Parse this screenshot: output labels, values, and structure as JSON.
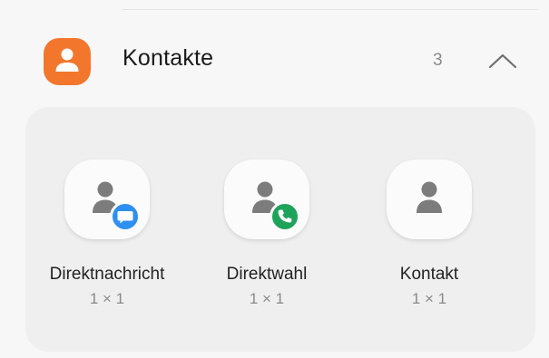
{
  "section": {
    "title": "Kontakte",
    "count": "3",
    "app_icon": "contacts-person-icon",
    "collapse_icon": "chevron-up-icon",
    "accent_color": "#f2772d"
  },
  "widgets": [
    {
      "label": "Direktnachricht",
      "size": "1 × 1",
      "icon": "person-icon",
      "badge": "message-bubble-icon",
      "badge_color": "#2d8ff0"
    },
    {
      "label": "Direktwahl",
      "size": "1 × 1",
      "icon": "person-icon",
      "badge": "phone-icon",
      "badge_color": "#1ea35b"
    },
    {
      "label": "Kontakt",
      "size": "1 × 1",
      "icon": "person-icon"
    }
  ]
}
